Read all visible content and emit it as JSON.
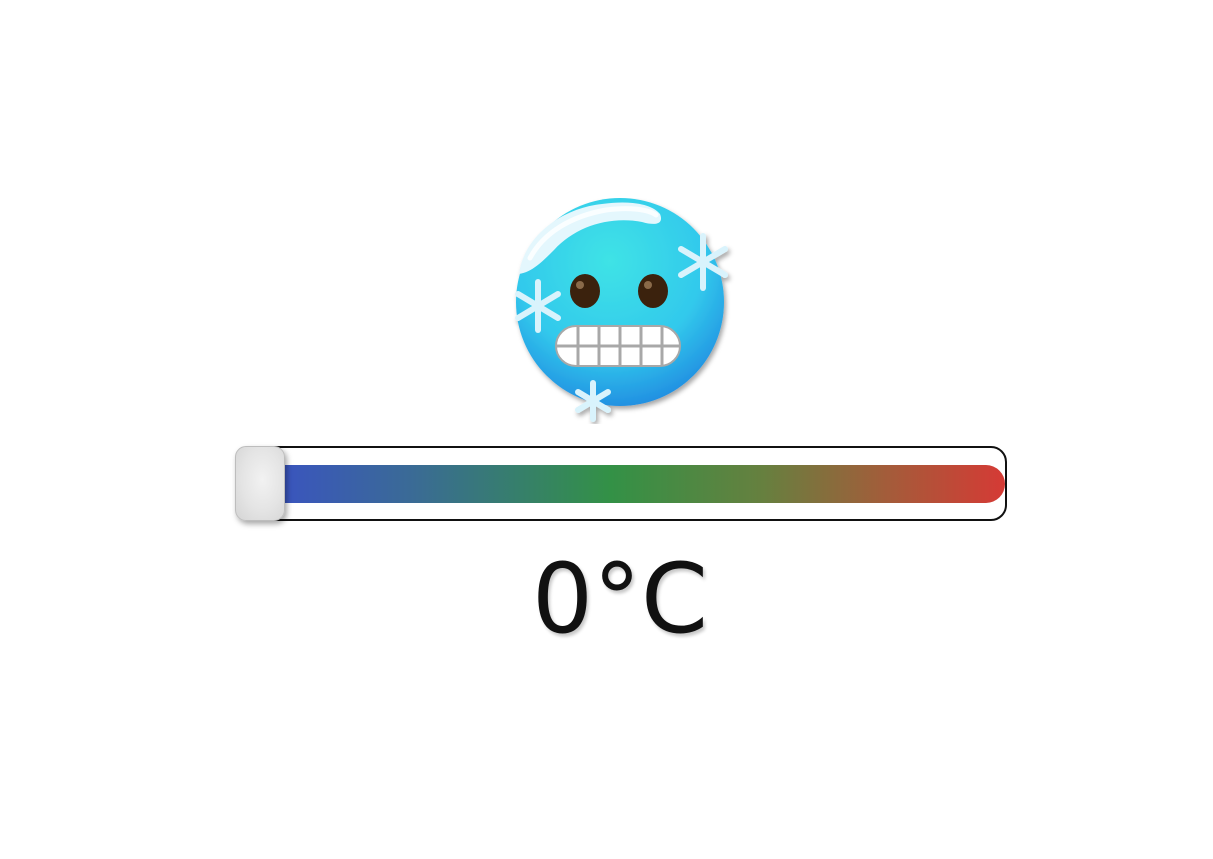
{
  "emoji": {
    "icon": "cold-face-icon",
    "face_color": "#3fd6e8",
    "snow_color": "#cdeffd"
  },
  "slider": {
    "value_percent": 0,
    "colors": [
      "#3a4fc9",
      "#339146",
      "#d53a35"
    ],
    "thumb_color": "#e6e6e6"
  },
  "temperature": {
    "value": 0,
    "unit": "°C",
    "display": "0°C"
  }
}
